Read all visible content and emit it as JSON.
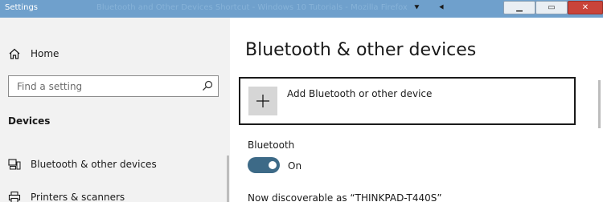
{
  "window": {
    "title": "Settings",
    "background_title": "Bluetooth and Other Devices Shortcut - Windows 10 Tutorials - Mozilla Firefox",
    "controls": {
      "minimize": "▁",
      "maximize": "▭",
      "close": "✕"
    }
  },
  "sidebar": {
    "home_label": "Home",
    "search_placeholder": "Find a setting",
    "section_title": "Devices",
    "items": [
      {
        "label": "Bluetooth & other devices",
        "icon": "bluetooth-devices-icon"
      },
      {
        "label": "Printers & scanners",
        "icon": "printer-icon"
      }
    ]
  },
  "main": {
    "title": "Bluetooth & other devices",
    "add_device_label": "Add Bluetooth or other device",
    "bluetooth_label": "Bluetooth",
    "toggle_state": "On",
    "discoverable_text": "Now discoverable as “THINKPAD-T440S”"
  },
  "colors": {
    "titlebar": "#6fa0cc",
    "sidebar_bg": "#f2f2f2",
    "toggle_on": "#3d6a87",
    "close_button": "#c9443a"
  }
}
